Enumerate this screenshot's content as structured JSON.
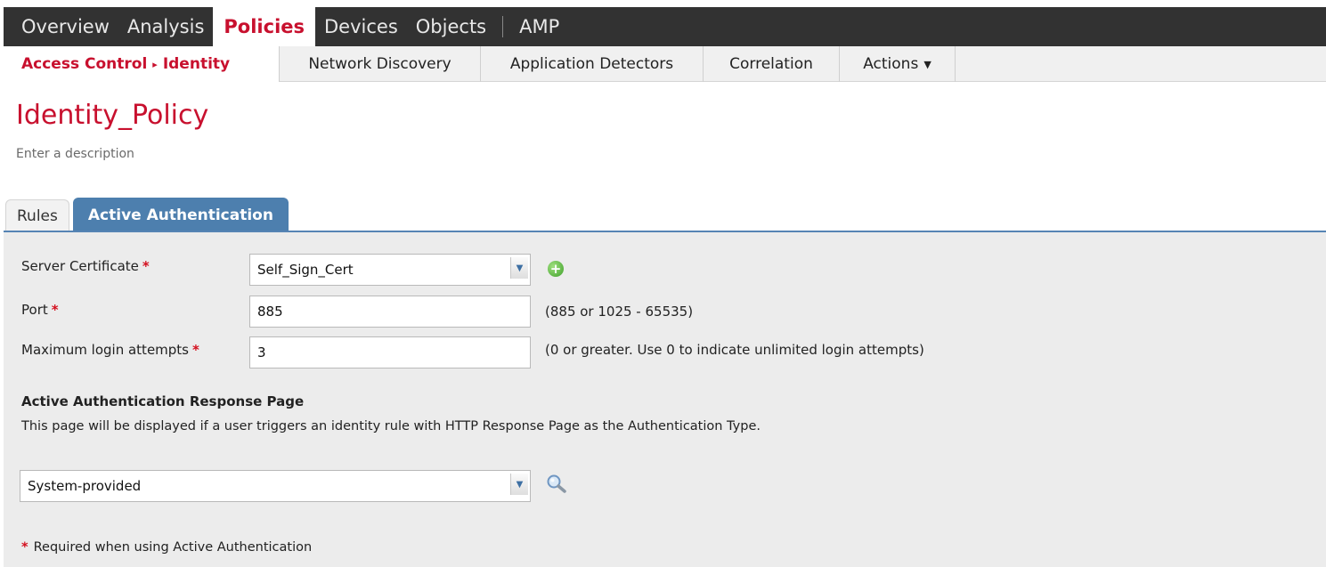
{
  "topnav": {
    "items": [
      "Overview",
      "Analysis",
      "Policies",
      "Devices",
      "Objects",
      "AMP"
    ],
    "active": "Policies"
  },
  "subnav": {
    "breadcrumb_parent": "Access Control",
    "breadcrumb_separator": "▸",
    "breadcrumb_current": "Identity",
    "items": [
      "Network Discovery",
      "Application Detectors",
      "Correlation",
      "Actions"
    ]
  },
  "policy": {
    "title": "Identity_Policy",
    "description": "Enter a description"
  },
  "tabs": {
    "rules": "Rules",
    "active_auth": "Active Authentication"
  },
  "form": {
    "server_certificate": {
      "label": "Server Certificate",
      "value": "Self_Sign_Cert"
    },
    "port": {
      "label": "Port",
      "value": "885",
      "hint": "(885 or 1025 - 65535)"
    },
    "max_login": {
      "label": "Maximum login attempts",
      "value": "3",
      "hint": "(0 or greater. Use 0 to indicate unlimited login attempts)"
    },
    "required_marker": "*"
  },
  "response_page": {
    "title": "Active Authentication Response Page",
    "description": "This page will be displayed if a user triggers an identity rule with HTTP Response Page as the Authentication Type.",
    "value": "System-provided"
  },
  "footnote": "Required when using Active Authentication",
  "icons": {
    "add": "plus-circle-icon",
    "search": "magnifier-icon",
    "dropdown": "chevron-down-icon"
  },
  "colors": {
    "accent_red": "#c8102e",
    "tab_blue": "#4d7fae",
    "nav_dark": "#323232"
  }
}
